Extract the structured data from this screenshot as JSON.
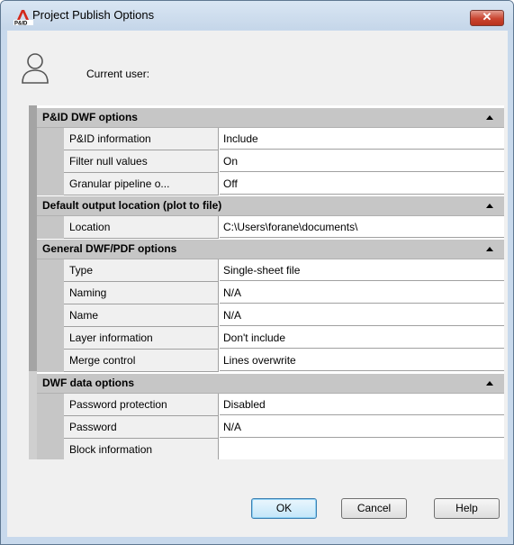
{
  "window": {
    "title": "Project Publish Options",
    "close_symbol": "✕"
  },
  "user": {
    "label": "Current user:"
  },
  "sections": [
    {
      "title": "P&ID DWF options",
      "rows": [
        {
          "name": "P&ID information",
          "value": "Include"
        },
        {
          "name": "Filter null values",
          "value": "On"
        },
        {
          "name": "Granular pipeline o...",
          "value": "Off"
        }
      ]
    },
    {
      "title": "Default output location (plot to file)",
      "rows": [
        {
          "name": "Location",
          "value": "C:\\Users\\forane\\documents\\"
        }
      ]
    },
    {
      "title": "General DWF/PDF options",
      "rows": [
        {
          "name": "Type",
          "value": "Single-sheet file"
        },
        {
          "name": "Naming",
          "value": "N/A"
        },
        {
          "name": "Name",
          "value": "N/A"
        },
        {
          "name": "Layer information",
          "value": "Don't include"
        },
        {
          "name": "Merge control",
          "value": "Lines overwrite"
        }
      ]
    },
    {
      "title": "DWF data options",
      "rows": [
        {
          "name": "Password protection",
          "value": "Disabled"
        },
        {
          "name": "Password",
          "value": "N/A"
        },
        {
          "name": "Block information",
          "value": ""
        }
      ]
    }
  ],
  "buttons": {
    "ok": "OK",
    "cancel": "Cancel",
    "help": "Help"
  },
  "icons": {
    "app": "autocad-pid-icon",
    "user": "user-icon",
    "collapse": "caret-up-icon"
  },
  "colors": {
    "title_bar": "#c8d9ec",
    "close_button": "#c9442f",
    "section_header": "#c6c6c6"
  }
}
